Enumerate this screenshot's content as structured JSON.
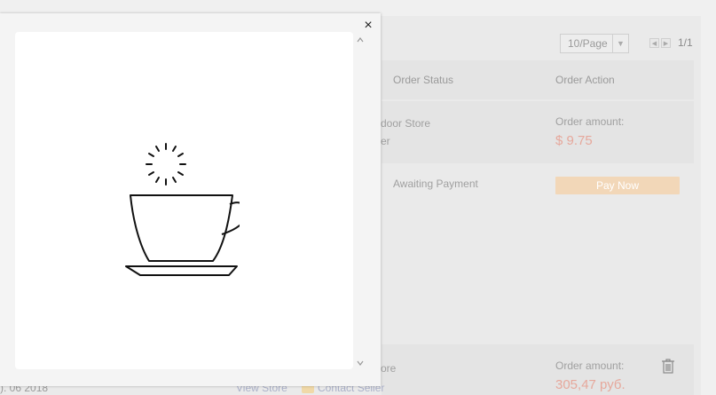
{
  "pager": {
    "per_page": "10/Page",
    "page_count": "1/1"
  },
  "table": {
    "headers": {
      "status": "Order Status",
      "action": "Order Action"
    },
    "row1": {
      "store_partial": "door Store",
      "seller_partial": "er",
      "status": "Awaiting Payment",
      "amount_label": "Order amount:",
      "amount_value": "$ 9.75",
      "pay_button": "Pay Now"
    },
    "row2": {
      "store_partial": "ore",
      "amount_label": "Order amount:",
      "amount_value": "305,47 руб.",
      "date_partial": "). 06 2018",
      "view_store": "View Store",
      "contact_seller": "Contact Seller"
    }
  },
  "modal": {
    "close_symbol": "×",
    "scroll_up_symbol": "⌃",
    "scroll_down_symbol": "⌄"
  },
  "colors": {
    "amount": "#e6a89c",
    "pay_button_bg": "#f2d7b8"
  },
  "icons": [
    "close-icon",
    "coffee-cup-loading-icon",
    "trash-icon",
    "chevron-up-icon",
    "chevron-down-icon"
  ]
}
